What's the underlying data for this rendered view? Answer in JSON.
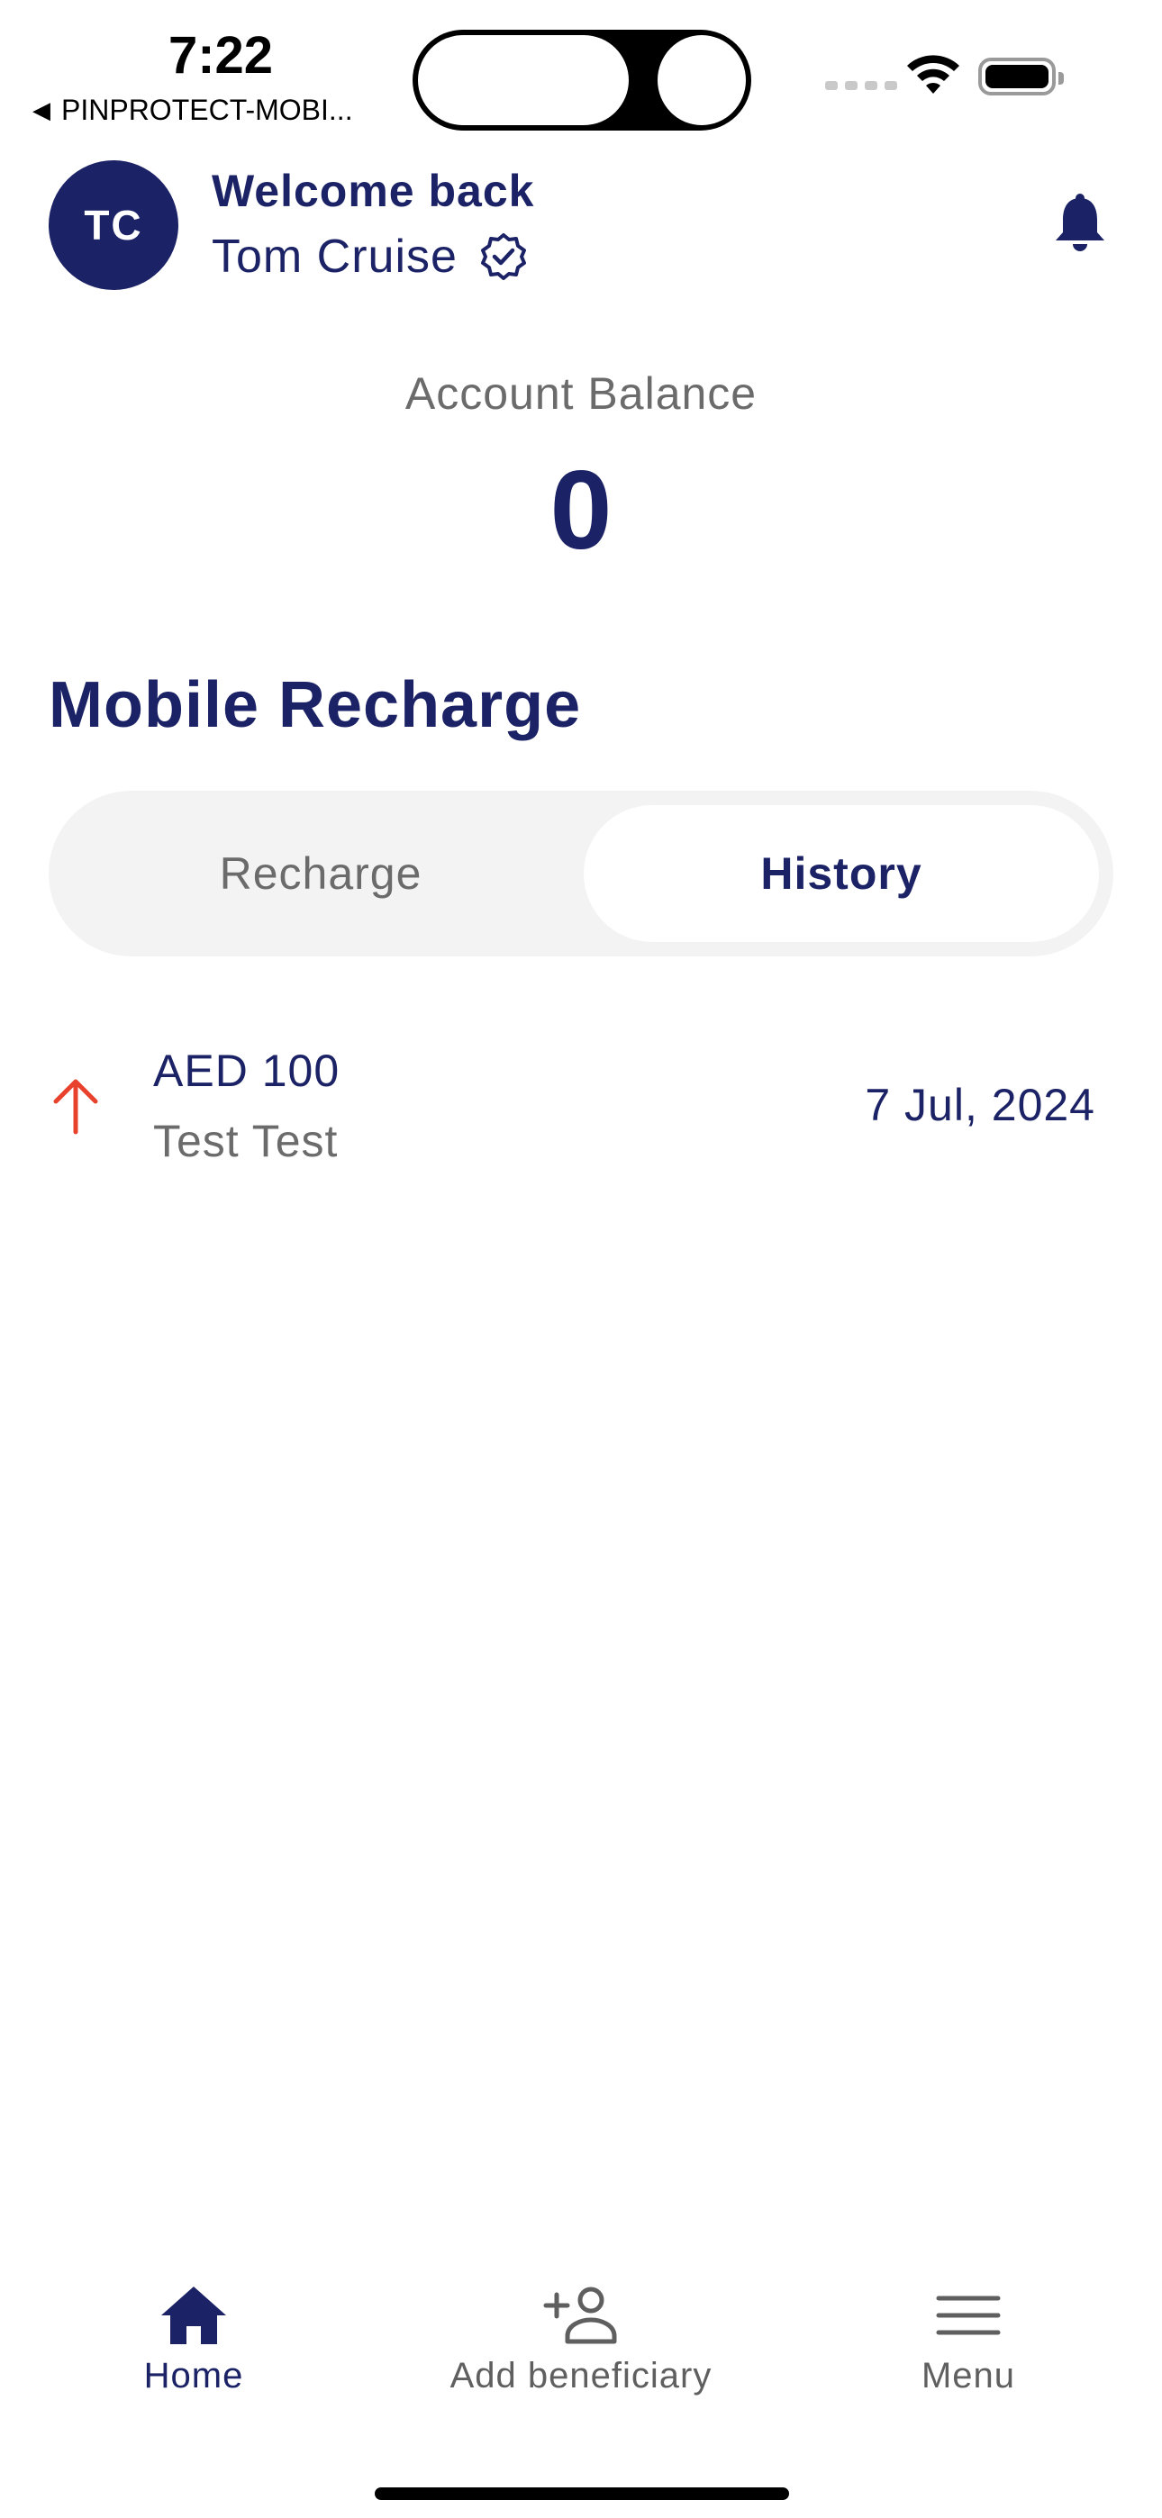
{
  "status_bar": {
    "time": "7:22",
    "back_app_label": "PINPROTECT-MOBI...",
    "back_arrow_glyph": "◀"
  },
  "header": {
    "avatar_initials": "TC",
    "welcome": "Welcome back",
    "user_name": "Tom Cruise",
    "verified_icon": "verified-badge-icon",
    "notification_icon": "bell-icon"
  },
  "balance": {
    "label": "Account Balance",
    "value": "0"
  },
  "section": {
    "title": "Mobile Recharge"
  },
  "tabs": [
    {
      "label": "Recharge",
      "active": false
    },
    {
      "label": "History",
      "active": true
    }
  ],
  "history": [
    {
      "icon": "arrow-up-icon",
      "amount": "AED 100",
      "name": "Test Test",
      "date": "7 Jul, 2024"
    }
  ],
  "bottom_nav": [
    {
      "label": "Home",
      "icon": "home-icon",
      "active": true
    },
    {
      "label": "Add beneficiary",
      "icon": "add-person-icon",
      "active": false
    },
    {
      "label": "Menu",
      "icon": "menu-icon",
      "active": false
    }
  ],
  "colors": {
    "primary": "#1b2266",
    "muted": "#6b6b6b",
    "accent_red": "#e8412c",
    "segment_bg": "#f3f3f3"
  }
}
